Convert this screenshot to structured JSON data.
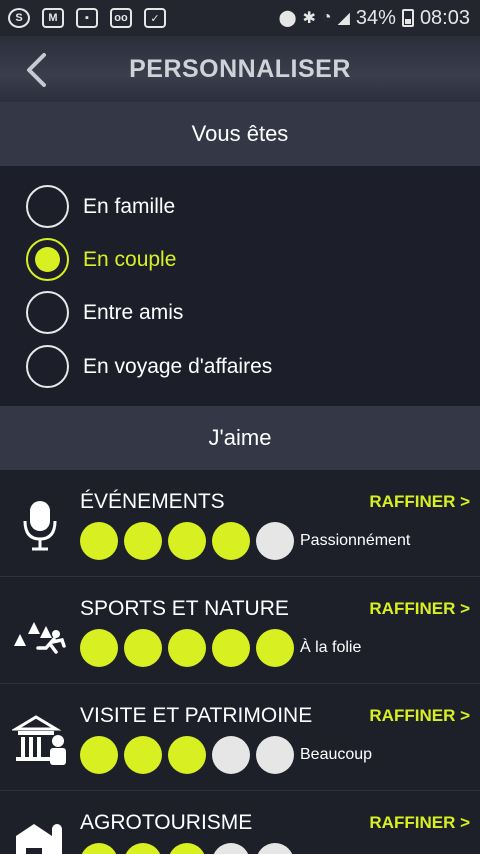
{
  "statusbar": {
    "left_icons": [
      "skype-icon",
      "gmail-icon",
      "gallery-icon",
      "voicemail-icon",
      "download-icon"
    ],
    "battery": "34%",
    "time": "08:03"
  },
  "appbar": {
    "title": "PERSONNALISER"
  },
  "section_profile": {
    "title": "Vous êtes",
    "options": [
      {
        "label": "En famille",
        "selected": false
      },
      {
        "label": "En couple",
        "selected": true
      },
      {
        "label": "Entre amis",
        "selected": false
      },
      {
        "label": "En voyage d'affaires",
        "selected": false
      }
    ]
  },
  "section_likes": {
    "title": "J'aime",
    "items": [
      {
        "title": "ÉVÉNEMENTS",
        "refine": "RAFFINER >",
        "level_label": "Passionnément",
        "rating": 4,
        "max": 5,
        "icon": "microphone-icon"
      },
      {
        "title": "SPORTS ET NATURE",
        "refine": "RAFFINER >",
        "level_label": "À la folie",
        "rating": 5,
        "max": 5,
        "icon": "runner-trees-icon"
      },
      {
        "title": "VISITE ET PATRIMOINE",
        "refine": "RAFFINER >",
        "level_label": "Beaucoup",
        "rating": 3,
        "max": 5,
        "icon": "monument-guide-icon"
      },
      {
        "title": "AGROTOURISME",
        "refine": "RAFFINER >",
        "level_label": "",
        "rating": 3,
        "max": 5,
        "icon": "barn-icon"
      }
    ]
  },
  "colors": {
    "accent": "#d8f021",
    "background": "#1c1f29",
    "header": "#343846"
  }
}
